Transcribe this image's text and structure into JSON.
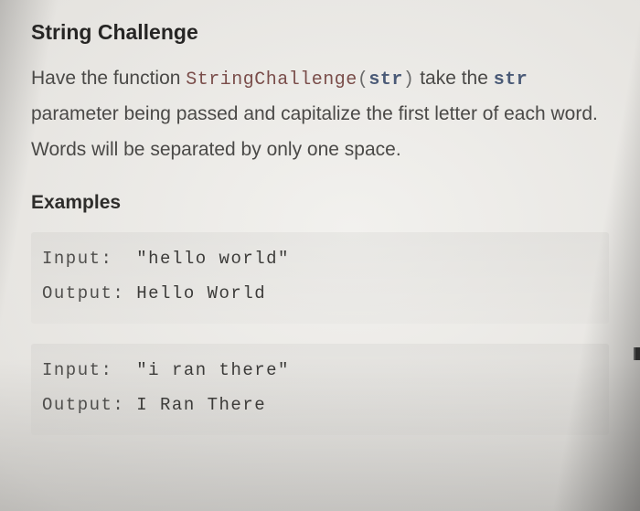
{
  "title": "String Challenge",
  "description": {
    "lead": "Have the function ",
    "fn_name": "StringChallenge",
    "open_paren": "(",
    "param_name": "str",
    "close_paren": ")",
    "after_sig": " take the ",
    "param_ref": "str",
    "tail": " parameter being passed and capitalize the first letter of each word. Words will be separated by only one space."
  },
  "examples_heading": "Examples",
  "examples": [
    {
      "input_label": "Input: ",
      "input_value": "\"hello world\"",
      "output_label": "Output: ",
      "output_value": "Hello World"
    },
    {
      "input_label": "Input: ",
      "input_value": "\"i ran there\"",
      "output_label": "Output: ",
      "output_value": "I Ran There"
    }
  ]
}
